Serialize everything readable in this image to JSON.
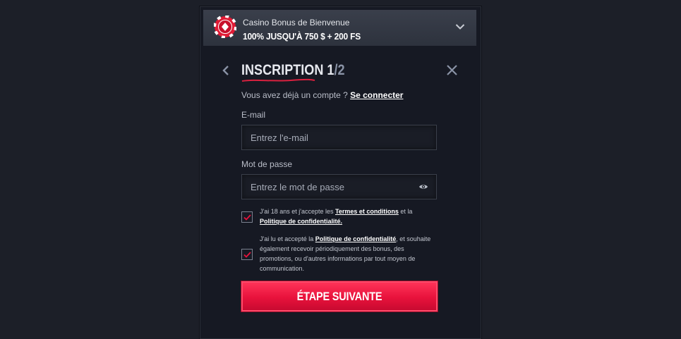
{
  "bonus": {
    "subtitle": "Casino Bonus de Bienvenue",
    "offer": "100% JUSQU'À 750 $ + 200 FS"
  },
  "header": {
    "title": "INSCRIPTION",
    "step_current": "1",
    "step_total": "/2"
  },
  "login": {
    "question": "Vous avez déjà un compte ? ",
    "link": "Se connecter"
  },
  "email": {
    "label": "E-mail",
    "placeholder": "Entrez l'e-mail"
  },
  "password": {
    "label": "Mot de passe",
    "placeholder": "Entrez le mot de passe"
  },
  "terms": {
    "checked": true,
    "text1": "J'ai 18 ans et j'accepte les ",
    "link1": "Termes et conditions",
    "text2": " et la ",
    "link2": "Politique de confidentialité."
  },
  "marketing": {
    "checked": true,
    "text1": "J'ai lu et accepté la ",
    "link1": "Politique de confidentialité",
    "text2": ", et souhaite également recevoir périodiquement des bonus, des promotions, ou d'autres informations par tout moyen de communication."
  },
  "cta": {
    "label": "ÉTAPE SUIVANTE"
  },
  "colors": {
    "accent": "#e8123c",
    "background": "#1c1f28",
    "panel": "#161923"
  }
}
